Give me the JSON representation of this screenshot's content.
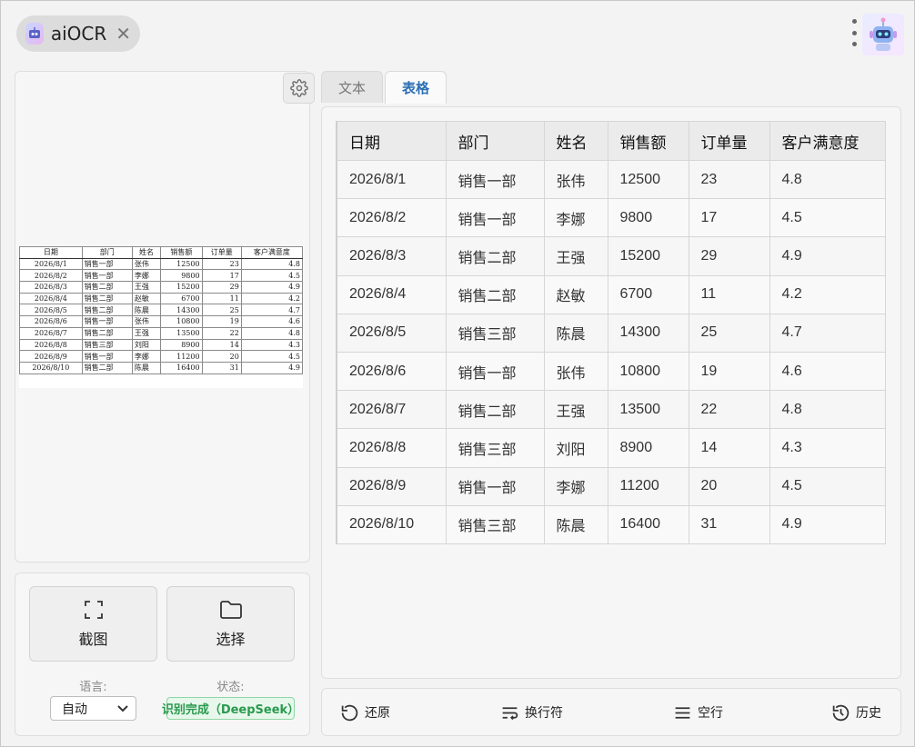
{
  "app": {
    "title": "aiOCR",
    "close_glyph": "✕"
  },
  "preview": {
    "columns": [
      "日期",
      "部门",
      "姓名",
      "销售额",
      "订单量",
      "客户满意度"
    ],
    "rows": [
      [
        "2026/8/1",
        "销售一部",
        "张伟",
        "12500",
        "23",
        "4.8"
      ],
      [
        "2026/8/2",
        "销售一部",
        "李娜",
        "9800",
        "17",
        "4.5"
      ],
      [
        "2026/8/3",
        "销售二部",
        "王强",
        "15200",
        "29",
        "4.9"
      ],
      [
        "2026/8/4",
        "销售二部",
        "赵敏",
        "6700",
        "11",
        "4.2"
      ],
      [
        "2026/8/5",
        "销售二部",
        "陈晨",
        "14300",
        "25",
        "4.7"
      ],
      [
        "2026/8/6",
        "销售一部",
        "张伟",
        "10800",
        "19",
        "4.6"
      ],
      [
        "2026/8/7",
        "销售二部",
        "王强",
        "13500",
        "22",
        "4.8"
      ],
      [
        "2026/8/8",
        "销售三部",
        "刘阳",
        "8900",
        "14",
        "4.3"
      ],
      [
        "2026/8/9",
        "销售一部",
        "李娜",
        "11200",
        "20",
        "4.5"
      ],
      [
        "2026/8/10",
        "销售二部",
        "陈晨",
        "16400",
        "31",
        "4.9"
      ]
    ]
  },
  "controls": {
    "screenshot_label": "截图",
    "select_label": "选择",
    "language_label": "语言:",
    "language_value": "自动",
    "status_label": "状态:",
    "status_value": "识别完成（DeepSeek）"
  },
  "tabs": [
    {
      "label": "文本",
      "active": false
    },
    {
      "label": "表格",
      "active": true
    }
  ],
  "result_table": {
    "columns": [
      "日期",
      "部门",
      "姓名",
      "销售额",
      "订单量",
      "客户满意度"
    ],
    "rows": [
      [
        "2026/8/1",
        "销售一部",
        "张伟",
        "12500",
        "23",
        "4.8"
      ],
      [
        "2026/8/2",
        "销售一部",
        "李娜",
        "9800",
        "17",
        "4.5"
      ],
      [
        "2026/8/3",
        "销售二部",
        "王强",
        "15200",
        "29",
        "4.9"
      ],
      [
        "2026/8/4",
        "销售二部",
        "赵敏",
        "6700",
        "11",
        "4.2"
      ],
      [
        "2026/8/5",
        "销售三部",
        "陈晨",
        "14300",
        "25",
        "4.7"
      ],
      [
        "2026/8/6",
        "销售一部",
        "张伟",
        "10800",
        "19",
        "4.6"
      ],
      [
        "2026/8/7",
        "销售二部",
        "王强",
        "13500",
        "22",
        "4.8"
      ],
      [
        "2026/8/8",
        "销售三部",
        "刘阳",
        "8900",
        "14",
        "4.3"
      ],
      [
        "2026/8/9",
        "销售一部",
        "李娜",
        "11200",
        "20",
        "4.5"
      ],
      [
        "2026/8/10",
        "销售三部",
        "陈晨",
        "16400",
        "31",
        "4.9"
      ]
    ]
  },
  "toolbar": {
    "restore_label": "还原",
    "linebreak_label": "换行符",
    "blankline_label": "空行",
    "history_label": "历史"
  },
  "colors": {
    "accent": "#2b6fb4",
    "status_green": "#2a9a4e",
    "status_bg": "#e8f7ec"
  },
  "icons": {
    "app": "robot-icon",
    "close": "close-icon",
    "menu": "more-vertical-icon",
    "avatar": "robot-avatar-icon",
    "settings": "gear-icon",
    "screenshot": "crop-icon",
    "select": "folder-icon",
    "dropdown": "chevron-down-icon",
    "restore": "undo-icon",
    "linebreak": "wrap-text-icon",
    "blankline": "menu-lines-icon",
    "history": "history-icon"
  }
}
